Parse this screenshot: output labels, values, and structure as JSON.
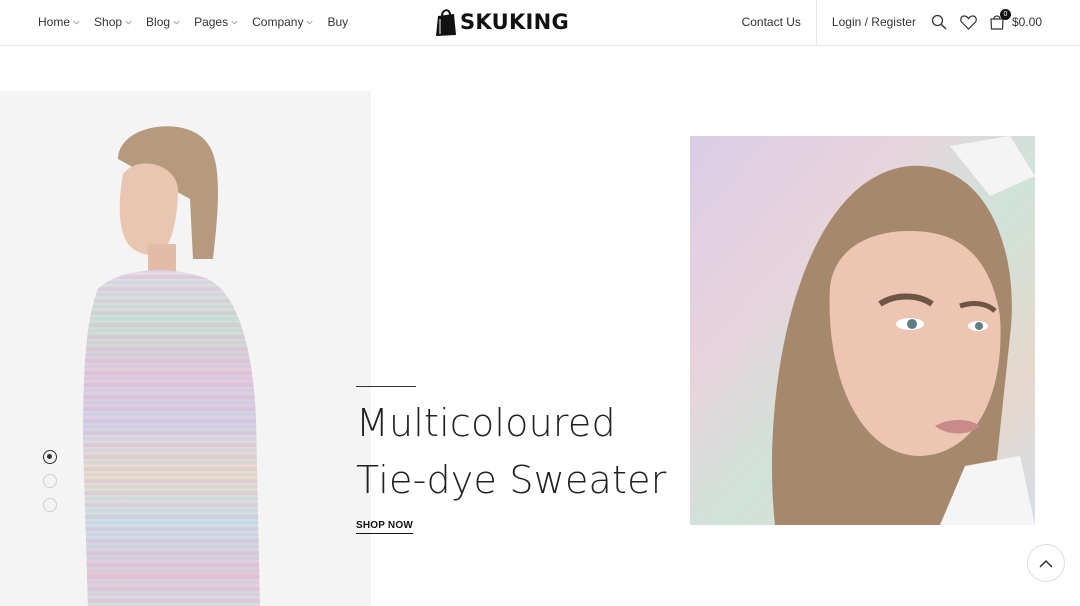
{
  "header": {
    "nav": [
      {
        "label": "Home",
        "has_dropdown": true
      },
      {
        "label": "Shop",
        "has_dropdown": true
      },
      {
        "label": "Blog",
        "has_dropdown": true
      },
      {
        "label": "Pages",
        "has_dropdown": true
      },
      {
        "label": "Company",
        "has_dropdown": true
      },
      {
        "label": "Buy",
        "has_dropdown": false
      }
    ],
    "logo_text": "SKUKING",
    "contact_label": "Contact Us",
    "login_label": "Login / Register",
    "cart_count": "0",
    "cart_total": "$0.00",
    "icons": [
      "search-icon",
      "heart-icon",
      "cart-icon"
    ]
  },
  "hero": {
    "headline_line1": "Multicoloured",
    "headline_line2": "Tie-dye Sweater",
    "cta_label": "SHOP NOW",
    "slides_total": 3,
    "active_slide": 1
  },
  "colors": {
    "text": "#222222",
    "panel_bg": "#f4f4f4",
    "accent": "#111111"
  }
}
